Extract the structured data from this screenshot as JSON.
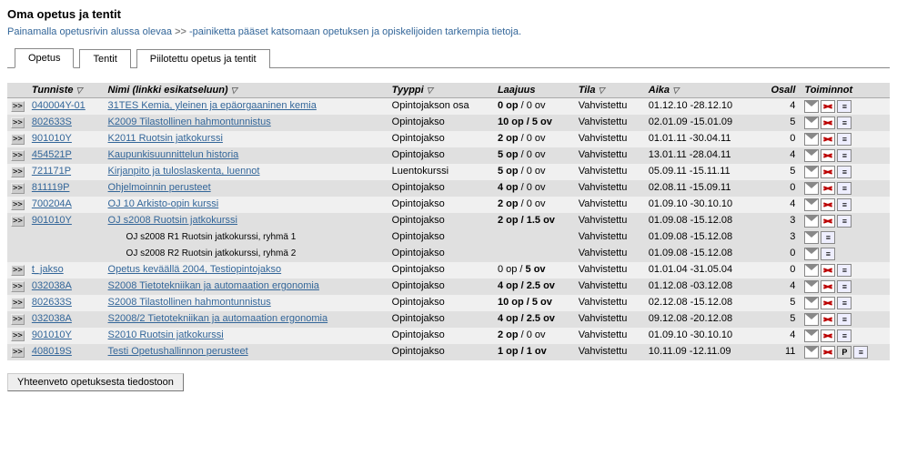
{
  "heading": "Oma opetus ja tentit",
  "intro_pre": "Painamalla opetusrivin alussa olevaa ",
  "intro_mark": ">>",
  "intro_post": " -painiketta pääset katsomaan opetuksen ja opiskelijoiden tarkempia tietoja.",
  "tabs": {
    "opetus": "Opetus",
    "tentit": "Tentit",
    "piilotettu": "Piilotettu opetus ja tentit"
  },
  "columns": {
    "tunniste": "Tunniste",
    "nimi": "Nimi (linkki esikatseluun)",
    "tyyppi": "Tyyppi",
    "laajuus": "Laajuus",
    "tila": "Tila",
    "aika": "Aika",
    "osall": "Osall",
    "toiminnot": "Toiminnot"
  },
  "expand_glyph": ">>",
  "rows": [
    {
      "cls": "odd",
      "expand": true,
      "id": "040004Y-01",
      "name": "31TES Kemia, yleinen ja epäorgaaninen kemia",
      "type": "Opintojakson osa",
      "laaj_html": "<b>0 op</b> / 0 ov",
      "tila": "Vahvistettu",
      "aika": "01.12.10 -28.12.10",
      "osall": "4",
      "icons": [
        "mail",
        "del",
        "doc"
      ]
    },
    {
      "cls": "even",
      "expand": true,
      "id": "802633S",
      "name": "K2009 Tilastollinen hahmontunnistus",
      "type": "Opintojakso",
      "laaj_html": "<b>10 op / 5 ov</b>",
      "tila": "Vahvistettu",
      "aika": "02.01.09 -15.01.09",
      "osall": "5",
      "icons": [
        "mail",
        "del",
        "doc"
      ]
    },
    {
      "cls": "odd",
      "expand": true,
      "id": "901010Y",
      "name": "K2011 Ruotsin jatkokurssi",
      "type": "Opintojakso",
      "laaj_html": "<b>2 op</b> / 0 ov",
      "tila": "Vahvistettu",
      "aika": "01.01.11 -30.04.11",
      "osall": "0",
      "icons": [
        "mail",
        "del",
        "doc"
      ]
    },
    {
      "cls": "even",
      "expand": true,
      "id": "454521P",
      "name": "Kaupunkisuunnittelun historia",
      "type": "Opintojakso",
      "laaj_html": "<b>5 op</b> / 0 ov",
      "tila": "Vahvistettu",
      "aika": "13.01.11 -28.04.11",
      "osall": "4",
      "icons": [
        "mail",
        "del",
        "doc"
      ]
    },
    {
      "cls": "odd",
      "expand": true,
      "id": "721171P",
      "name": "Kirjanpito ja tuloslaskenta, luennot",
      "type": "Luentokurssi",
      "laaj_html": "<b>5 op</b> / 0 ov",
      "tila": "Vahvistettu",
      "aika": "05.09.11 -15.11.11",
      "osall": "5",
      "icons": [
        "mail",
        "del",
        "doc"
      ]
    },
    {
      "cls": "even",
      "expand": true,
      "id": "811119P",
      "name": "Ohjelmoinnin perusteet",
      "type": "Opintojakso",
      "laaj_html": "<b>4 op</b> / 0 ov",
      "tila": "Vahvistettu",
      "aika": "02.08.11 -15.09.11",
      "osall": "0",
      "icons": [
        "mail",
        "del",
        "doc"
      ]
    },
    {
      "cls": "odd",
      "expand": true,
      "id": "700204A",
      "name": "OJ 10 Arkisto-opin kurssi",
      "type": "Opintojakso",
      "laaj_html": "<b>2 op</b> / 0 ov",
      "tila": "Vahvistettu",
      "aika": "01.09.10 -30.10.10",
      "osall": "4",
      "icons": [
        "mail",
        "del",
        "doc"
      ]
    },
    {
      "cls": "even",
      "expand": true,
      "id": "901010Y",
      "name": "OJ s2008 Ruotsin jatkokurssi",
      "type": "Opintojakso",
      "laaj_html": "<b>2 op / 1.5 ov</b>",
      "tila": "Vahvistettu",
      "aika": "01.09.08 -15.12.08",
      "osall": "3",
      "icons": [
        "mail",
        "del",
        "doc"
      ]
    },
    {
      "cls": "even",
      "expand": false,
      "id": "",
      "name": "OJ s2008 R1 Ruotsin jatkokurssi, ryhmä 1",
      "child": true,
      "type": "Opintojakso",
      "laaj_html": "",
      "tila": "Vahvistettu",
      "aika": "01.09.08 -15.12.08",
      "osall": "3",
      "icons": [
        "mail",
        "doc"
      ]
    },
    {
      "cls": "even",
      "expand": false,
      "id": "",
      "name": "OJ s2008 R2 Ruotsin jatkokurssi, ryhmä 2",
      "child": true,
      "type": "Opintojakso",
      "laaj_html": "",
      "tila": "Vahvistettu",
      "aika": "01.09.08 -15.12.08",
      "osall": "0",
      "icons": [
        "mail",
        "doc"
      ]
    },
    {
      "cls": "odd",
      "expand": true,
      "id": "t_jakso",
      "name": "Opetus keväällä 2004, Testiopintojakso",
      "type": "Opintojakso",
      "laaj_html": "0 op / <b>5 ov</b>",
      "tila": "Vahvistettu",
      "aika": "01.01.04 -31.05.04",
      "osall": "0",
      "icons": [
        "mail",
        "del",
        "doc"
      ]
    },
    {
      "cls": "even",
      "expand": true,
      "id": "032038A",
      "name": "S2008 Tietotekniikan ja automaation ergonomia",
      "type": "Opintojakso",
      "laaj_html": "<b>4 op / 2.5 ov</b>",
      "tila": "Vahvistettu",
      "aika": "01.12.08 -03.12.08",
      "osall": "4",
      "icons": [
        "mail",
        "del",
        "doc"
      ]
    },
    {
      "cls": "odd",
      "expand": true,
      "id": "802633S",
      "name": "S2008 Tilastollinen hahmontunnistus",
      "type": "Opintojakso",
      "laaj_html": "<b>10 op / 5 ov</b>",
      "tila": "Vahvistettu",
      "aika": "02.12.08 -15.12.08",
      "osall": "5",
      "icons": [
        "mail",
        "del",
        "doc"
      ]
    },
    {
      "cls": "even",
      "expand": true,
      "id": "032038A",
      "name": "S2008/2 Tietotekniikan ja automaation ergonomia",
      "type": "Opintojakso",
      "laaj_html": "<b>4 op / 2.5 ov</b>",
      "tila": "Vahvistettu",
      "aika": "09.12.08 -20.12.08",
      "osall": "5",
      "icons": [
        "mail",
        "del",
        "doc"
      ]
    },
    {
      "cls": "odd",
      "expand": true,
      "id": "901010Y",
      "name": "S2010 Ruotsin jatkokurssi",
      "type": "Opintojakso",
      "laaj_html": "<b>2 op</b> / 0 ov",
      "tila": "Vahvistettu",
      "aika": "01.09.10 -30.10.10",
      "osall": "4",
      "icons": [
        "mail",
        "del",
        "doc"
      ]
    },
    {
      "cls": "even",
      "expand": true,
      "id": "408019S",
      "name": "Testi Opetushallinnon perusteet",
      "type": "Opintojakso",
      "laaj_html": "<b>1 op / 1 ov</b>",
      "tila": "Vahvistettu",
      "aika": "10.11.09 -12.11.09",
      "osall": "11",
      "icons": [
        "mail",
        "del",
        "p",
        "doc"
      ]
    }
  ],
  "button": "Yhteenveto opetuksesta tiedostoon"
}
